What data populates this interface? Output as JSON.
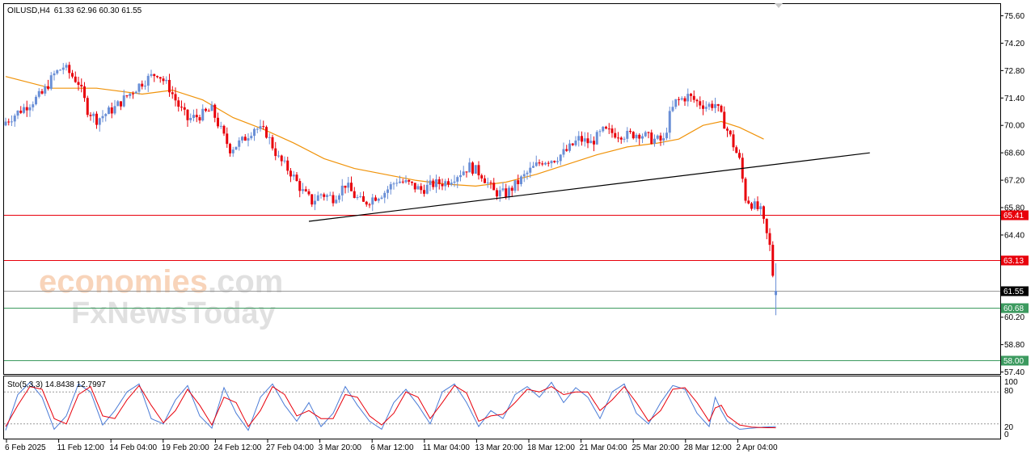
{
  "header": {
    "symbol_tf": "OILUSD,H4",
    "ohlc": "61.33 62.96 60.30 61.55"
  },
  "watermark": {
    "line1_a": "economies",
    "line1_b": ".com",
    "line2": "FxNewsToday"
  },
  "indicator": {
    "label": "Sto(5,3,3) 14.8438 12.7997",
    "levels": [
      "100",
      "80",
      "20",
      "0"
    ]
  },
  "colors": {
    "bull": "#6a8fd6",
    "bear": "#e8000b",
    "ma": "#f0930a",
    "resistance": "#e8000b",
    "support": "#3c9a5f",
    "trendline": "#000000",
    "stoch_main": "#4a7bd6",
    "stoch_signal": "#e8000b"
  },
  "chart_data": {
    "type": "candlestick",
    "symbol": "OILUSD",
    "timeframe": "H4",
    "last_ohlc": {
      "open": 61.33,
      "high": 62.96,
      "low": 60.3,
      "close": 61.55
    },
    "y_ticks": [
      "75.60",
      "74.20",
      "72.80",
      "71.40",
      "70.00",
      "68.60",
      "67.20",
      "65.80",
      "64.40",
      "63.00",
      "61.60",
      "60.20",
      "58.80",
      "57.40"
    ],
    "y_range": [
      57.3,
      76.2
    ],
    "x_labels": [
      "6 Feb 2025",
      "11 Feb 12:00",
      "14 Feb 04:00",
      "19 Feb 20:00",
      "24 Feb 12:00",
      "27 Feb 04:00",
      "3 Mar 20:00",
      "6 Mar 12:00",
      "11 Mar 04:00",
      "13 Mar 20:00",
      "18 Mar 12:00",
      "21 Mar 04:00",
      "25 Mar 20:00",
      "28 Mar 12:00",
      "2 Apr 04:00"
    ],
    "price_levels": [
      {
        "value": 65.41,
        "label": "65.41",
        "kind": "resistance"
      },
      {
        "value": 63.13,
        "label": "63.13",
        "kind": "resistance"
      },
      {
        "value": 61.55,
        "label": "61.55",
        "kind": "current"
      },
      {
        "value": 60.68,
        "label": "60.68",
        "kind": "support"
      },
      {
        "value": 58.0,
        "label": "58.00",
        "kind": "support"
      }
    ],
    "close_path": [
      [
        0,
        70.2
      ],
      [
        6,
        70.9
      ],
      [
        12,
        71.6
      ],
      [
        16,
        72.6
      ],
      [
        19,
        73.0
      ],
      [
        24,
        72.2
      ],
      [
        27,
        70.8
      ],
      [
        30,
        70.3
      ],
      [
        36,
        70.9
      ],
      [
        40,
        71.5
      ],
      [
        45,
        72.2
      ],
      [
        50,
        72.7
      ],
      [
        54,
        71.9
      ],
      [
        57,
        71.0
      ],
      [
        60,
        70.3
      ],
      [
        64,
        70.5
      ],
      [
        68,
        70.8
      ],
      [
        72,
        69.4
      ],
      [
        74,
        68.8
      ],
      [
        78,
        69.2
      ],
      [
        82,
        69.9
      ],
      [
        86,
        69.6
      ],
      [
        90,
        68.3
      ],
      [
        94,
        67.6
      ],
      [
        98,
        66.6
      ],
      [
        101,
        66.1
      ],
      [
        104,
        66.5
      ],
      [
        108,
        66.3
      ],
      [
        112,
        67.0
      ],
      [
        115,
        66.4
      ],
      [
        118,
        66.0
      ],
      [
        121,
        66.3
      ],
      [
        125,
        66.6
      ],
      [
        129,
        67.2
      ],
      [
        133,
        67.0
      ],
      [
        137,
        66.7
      ],
      [
        141,
        67.0
      ],
      [
        145,
        67.1
      ],
      [
        149,
        67.5
      ],
      [
        153,
        67.9
      ],
      [
        157,
        67.5
      ],
      [
        161,
        66.6
      ],
      [
        165,
        66.5
      ],
      [
        169,
        67.1
      ],
      [
        173,
        67.7
      ],
      [
        177,
        68.2
      ],
      [
        181,
        68.3
      ],
      [
        185,
        68.7
      ],
      [
        189,
        69.3
      ],
      [
        193,
        69.1
      ],
      [
        197,
        69.7
      ],
      [
        201,
        69.6
      ],
      [
        205,
        69.5
      ],
      [
        209,
        69.6
      ],
      [
        213,
        69.3
      ],
      [
        217,
        69.2
      ],
      [
        219,
        70.5
      ],
      [
        221,
        71.2
      ],
      [
        225,
        71.5
      ],
      [
        228,
        71.2
      ],
      [
        231,
        71.0
      ],
      [
        234,
        71.1
      ],
      [
        237,
        70.1
      ],
      [
        239,
        69.4
      ],
      [
        242,
        68.2
      ],
      [
        244,
        66.3
      ],
      [
        246,
        66.0
      ],
      [
        249,
        65.6
      ],
      [
        252,
        63.8
      ],
      [
        253,
        62.4
      ],
      [
        254,
        61.55
      ]
    ],
    "n_bars": 255,
    "moving_average": [
      [
        0,
        72.5
      ],
      [
        15,
        71.9
      ],
      [
        30,
        71.9
      ],
      [
        45,
        71.6
      ],
      [
        55,
        71.8
      ],
      [
        65,
        71.3
      ],
      [
        75,
        70.4
      ],
      [
        85,
        69.8
      ],
      [
        95,
        69.1
      ],
      [
        105,
        68.3
      ],
      [
        115,
        67.8
      ],
      [
        125,
        67.5
      ],
      [
        135,
        67.2
      ],
      [
        145,
        67.0
      ],
      [
        155,
        66.9
      ],
      [
        165,
        67.1
      ],
      [
        175,
        67.5
      ],
      [
        185,
        68.0
      ],
      [
        195,
        68.5
      ],
      [
        205,
        68.9
      ],
      [
        215,
        69.1
      ],
      [
        222,
        69.3
      ],
      [
        230,
        70.0
      ],
      [
        236,
        70.2
      ],
      [
        242,
        69.9
      ],
      [
        246,
        69.6
      ],
      [
        250,
        69.3
      ]
    ],
    "trendline": {
      "from": [
        100,
        65.1
      ],
      "to": [
        285,
        68.6
      ]
    },
    "stochastic": {
      "main": [
        [
          0,
          8
        ],
        [
          4,
          75
        ],
        [
          8,
          98
        ],
        [
          12,
          70
        ],
        [
          16,
          10
        ],
        [
          20,
          35
        ],
        [
          24,
          95
        ],
        [
          28,
          80
        ],
        [
          32,
          18
        ],
        [
          36,
          45
        ],
        [
          40,
          80
        ],
        [
          44,
          95
        ],
        [
          48,
          30
        ],
        [
          52,
          20
        ],
        [
          56,
          65
        ],
        [
          60,
          92
        ],
        [
          64,
          35
        ],
        [
          68,
          12
        ],
        [
          72,
          88
        ],
        [
          76,
          40
        ],
        [
          80,
          8
        ],
        [
          84,
          70
        ],
        [
          88,
          95
        ],
        [
          92,
          55
        ],
        [
          96,
          25
        ],
        [
          100,
          60
        ],
        [
          104,
          15
        ],
        [
          108,
          40
        ],
        [
          112,
          90
        ],
        [
          116,
          55
        ],
        [
          120,
          25
        ],
        [
          124,
          10
        ],
        [
          128,
          60
        ],
        [
          132,
          85
        ],
        [
          136,
          55
        ],
        [
          140,
          20
        ],
        [
          144,
          80
        ],
        [
          148,
          95
        ],
        [
          152,
          60
        ],
        [
          156,
          15
        ],
        [
          160,
          45
        ],
        [
          164,
          30
        ],
        [
          168,
          75
        ],
        [
          172,
          90
        ],
        [
          176,
          70
        ],
        [
          180,
          98
        ],
        [
          184,
          60
        ],
        [
          188,
          88
        ],
        [
          192,
          70
        ],
        [
          196,
          30
        ],
        [
          200,
          80
        ],
        [
          204,
          95
        ],
        [
          208,
          40
        ],
        [
          212,
          20
        ],
        [
          216,
          60
        ],
        [
          220,
          92
        ],
        [
          224,
          85
        ],
        [
          228,
          40
        ],
        [
          232,
          15
        ],
        [
          234,
          70
        ],
        [
          236,
          45
        ],
        [
          238,
          25
        ],
        [
          242,
          10
        ],
        [
          246,
          12
        ],
        [
          250,
          14
        ],
        [
          254,
          15
        ]
      ],
      "signal": [
        [
          0,
          15
        ],
        [
          4,
          55
        ],
        [
          8,
          90
        ],
        [
          12,
          85
        ],
        [
          16,
          30
        ],
        [
          20,
          20
        ],
        [
          24,
          75
        ],
        [
          28,
          90
        ],
        [
          32,
          35
        ],
        [
          36,
          30
        ],
        [
          40,
          65
        ],
        [
          44,
          92
        ],
        [
          48,
          55
        ],
        [
          52,
          22
        ],
        [
          56,
          45
        ],
        [
          60,
          85
        ],
        [
          64,
          55
        ],
        [
          68,
          18
        ],
        [
          72,
          70
        ],
        [
          76,
          60
        ],
        [
          80,
          15
        ],
        [
          84,
          45
        ],
        [
          88,
          90
        ],
        [
          92,
          75
        ],
        [
          96,
          35
        ],
        [
          100,
          45
        ],
        [
          104,
          30
        ],
        [
          108,
          30
        ],
        [
          112,
          75
        ],
        [
          116,
          70
        ],
        [
          120,
          35
        ],
        [
          124,
          18
        ],
        [
          128,
          40
        ],
        [
          132,
          80
        ],
        [
          136,
          70
        ],
        [
          140,
          30
        ],
        [
          144,
          60
        ],
        [
          148,
          92
        ],
        [
          152,
          78
        ],
        [
          156,
          25
        ],
        [
          160,
          35
        ],
        [
          164,
          38
        ],
        [
          168,
          60
        ],
        [
          172,
          85
        ],
        [
          176,
          80
        ],
        [
          180,
          90
        ],
        [
          184,
          75
        ],
        [
          188,
          80
        ],
        [
          192,
          80
        ],
        [
          196,
          45
        ],
        [
          200,
          65
        ],
        [
          204,
          90
        ],
        [
          208,
          60
        ],
        [
          212,
          25
        ],
        [
          216,
          45
        ],
        [
          220,
          85
        ],
        [
          224,
          88
        ],
        [
          228,
          60
        ],
        [
          232,
          25
        ],
        [
          234,
          50
        ],
        [
          236,
          55
        ],
        [
          238,
          35
        ],
        [
          242,
          18
        ],
        [
          246,
          14
        ],
        [
          250,
          13
        ],
        [
          254,
          12.8
        ]
      ]
    }
  }
}
